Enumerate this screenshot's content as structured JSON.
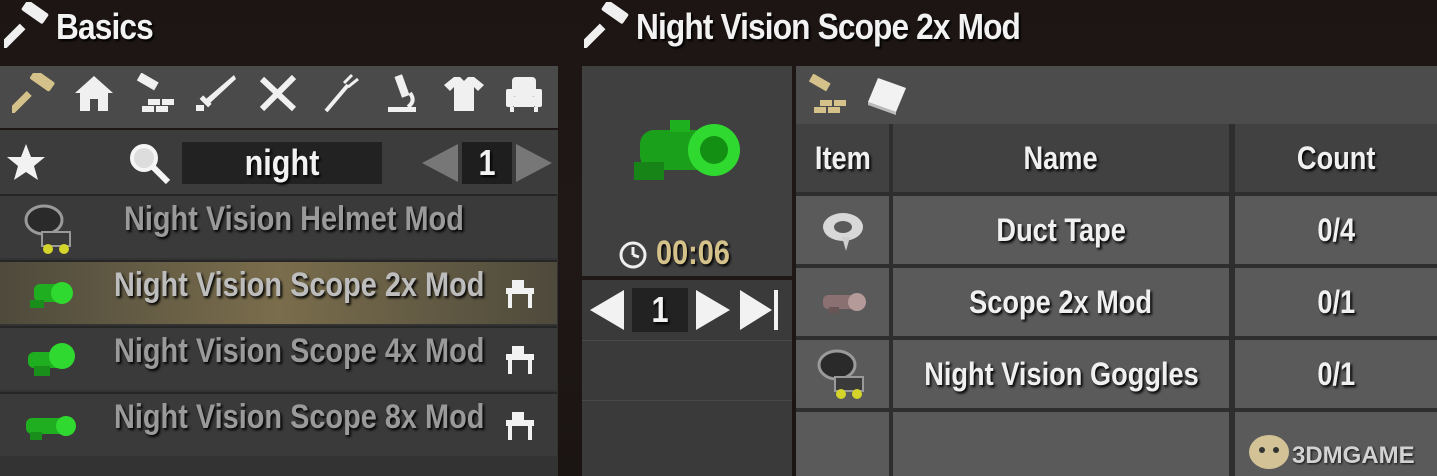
{
  "left": {
    "title": "Basics",
    "categories": [
      {
        "name": "hammer-icon"
      },
      {
        "name": "house-icon"
      },
      {
        "name": "building-icon"
      },
      {
        "name": "weapon-icon"
      },
      {
        "name": "tools-icon"
      },
      {
        "name": "fork-icon"
      },
      {
        "name": "microscope-icon"
      },
      {
        "name": "shirt-icon"
      },
      {
        "name": "chair-icon"
      }
    ],
    "search_value": "night",
    "page": "1",
    "recipes": [
      {
        "label": "Night Vision Helmet Mod",
        "selected": false,
        "workbench": false
      },
      {
        "label": "Night Vision Scope 2x Mod",
        "selected": true,
        "workbench": true
      },
      {
        "label": "Night Vision Scope 4x Mod",
        "selected": false,
        "workbench": true
      },
      {
        "label": "Night Vision Scope 8x Mod",
        "selected": false,
        "workbench": true
      }
    ]
  },
  "right": {
    "title": "Night Vision Scope 2x Mod",
    "craft_time": "00:06",
    "quantity": "1",
    "headers": {
      "item": "Item",
      "name": "Name",
      "count": "Count"
    },
    "ingredients": [
      {
        "name": "Duct Tape",
        "count": "0/4"
      },
      {
        "name": "Scope 2x Mod",
        "count": "0/1"
      },
      {
        "name": "Night Vision Goggles",
        "count": "0/1"
      }
    ]
  },
  "watermark": "3DMGAME",
  "colors": {
    "accent": "#d4c28a",
    "nv_green": "#2fd92f",
    "selected_row": "#6f6548"
  }
}
